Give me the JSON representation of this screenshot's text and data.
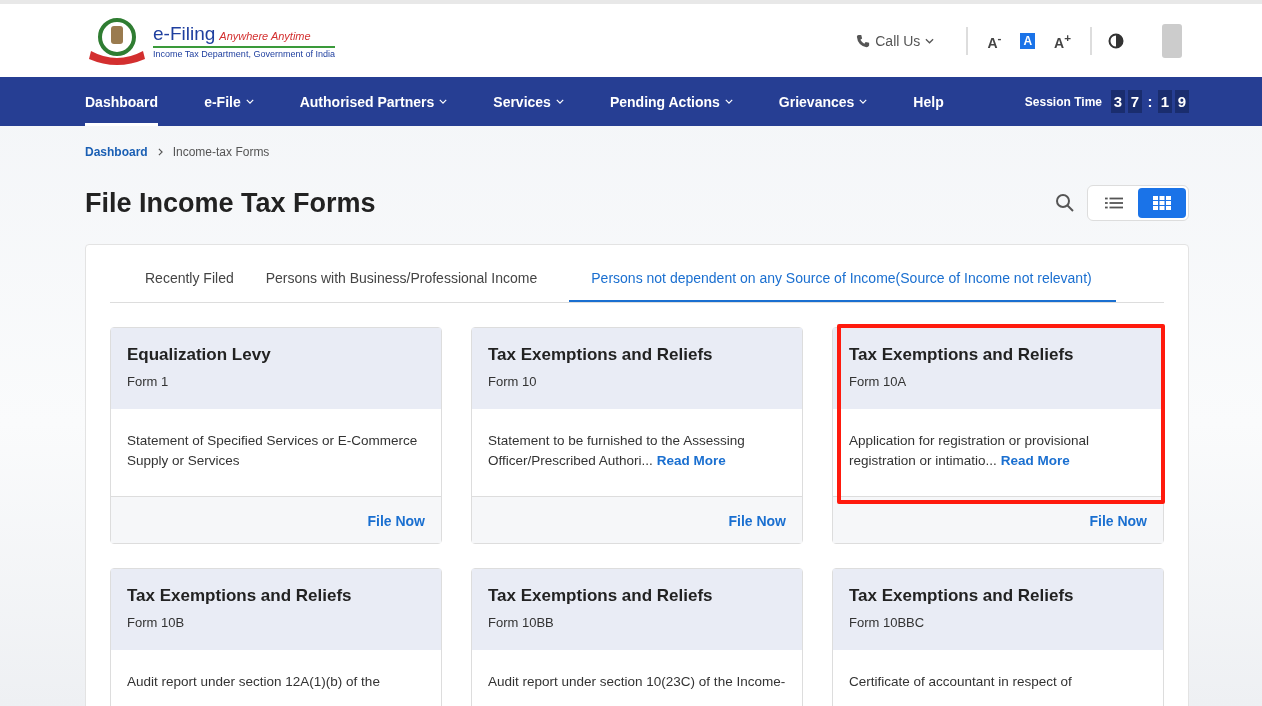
{
  "header": {
    "logo_title": "e-Filing",
    "logo_tagline": "Anywhere Anytime",
    "logo_subtitle": "Income Tax Department, Government of India",
    "call_us": "Call Us",
    "font_controls": [
      {
        "label": "A$^{-}$",
        "selected": false
      },
      {
        "label": "A",
        "selected": true
      },
      {
        "label": "A$^{+}$",
        "selected": false
      }
    ]
  },
  "nav": {
    "items": [
      {
        "label": "Dashboard",
        "dropdown": false,
        "selected": true
      },
      {
        "label": "e-File",
        "dropdown": true,
        "selected": false
      },
      {
        "label": "Authorised Partners",
        "dropdown": true,
        "selected": false
      },
      {
        "label": "Services",
        "dropdown": true,
        "selected": false
      },
      {
        "label": "Pending Actions",
        "dropdown": true,
        "selected": false
      },
      {
        "label": "Grievances",
        "dropdown": true,
        "selected": false
      },
      {
        "label": "Help",
        "dropdown": false,
        "selected": false
      }
    ],
    "session_label": "Session Time",
    "session_digits": [
      "3",
      "7",
      ":",
      "1",
      "9"
    ]
  },
  "breadcrumb": [
    "Dashboard",
    "Income-tax Forms"
  ],
  "page_title": "File Income Tax Forms",
  "view_toggle": [
    {
      "kind": "list",
      "selected": false
    },
    {
      "kind": "grid",
      "selected": true
    }
  ],
  "tabs": [
    {
      "label": "Recently Filed",
      "selected": false
    },
    {
      "label": "Persons with Business/Professional Income",
      "selected": false
    },
    {
      "label": "Persons not dependent on any Source of Income(Source of Income not relevant)",
      "selected": true
    }
  ],
  "cards": [
    {
      "title": "Equalization Levy",
      "form": "Form 1",
      "description": "Statement of Specified Services or E-Commerce Supply or Services",
      "action": "File Now",
      "highlighted": false
    },
    {
      "title": "Tax Exemptions and Reliefs",
      "form": "Form 10",
      "description": "Statement to be furnished to the Assessing Officer/Prescribed Authori...",
      "read_more": "Read More",
      "action": "File Now",
      "highlighted": false
    },
    {
      "title": "Tax Exemptions and Reliefs",
      "form": "Form 10A",
      "description": "Application for registration or provisional registration or intimatio...",
      "read_more": "Read More",
      "action": "File Now",
      "highlighted": true
    },
    {
      "title": "Tax Exemptions and Reliefs",
      "form": "Form 10B",
      "description": "Audit report under section 12A(1)(b) of the",
      "highlighted": false
    },
    {
      "title": "Tax Exemptions and Reliefs",
      "form": "Form 10BB",
      "description": "Audit report under section 10(23C) of the Income-",
      "highlighted": false
    },
    {
      "title": "Tax Exemptions and Reliefs",
      "form": "Form 10BBC",
      "description": "Certificate of accountant in respect of",
      "highlighted": false
    }
  ]
}
